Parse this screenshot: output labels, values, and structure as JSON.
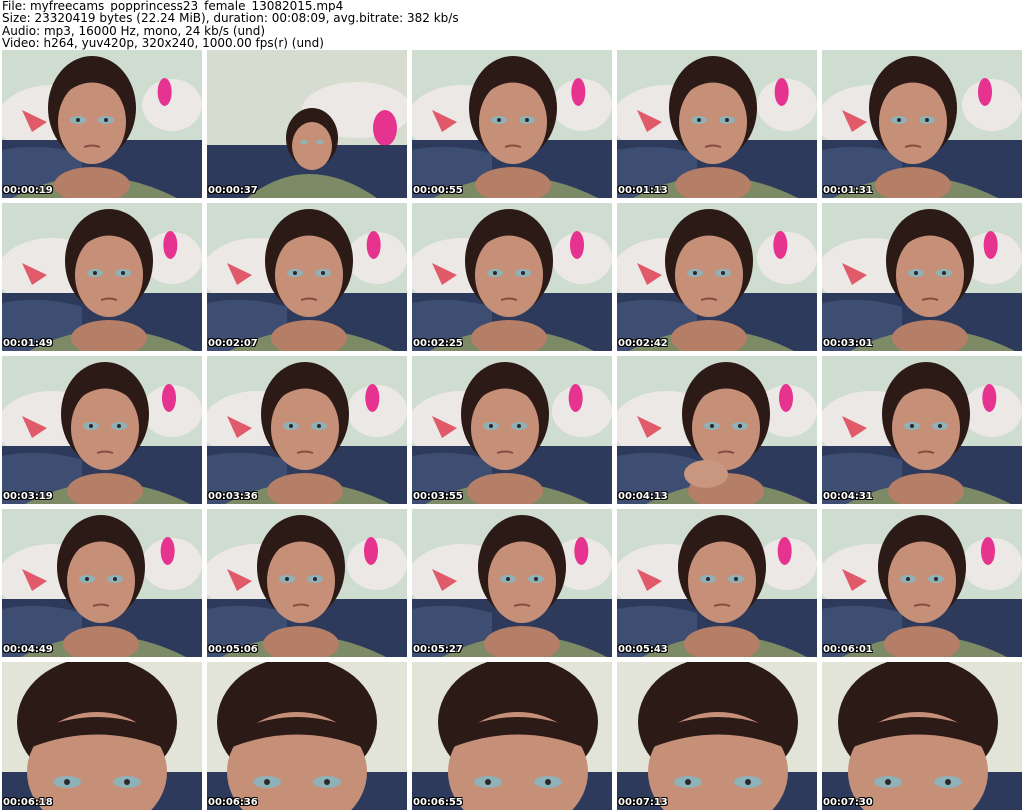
{
  "header": {
    "file_line": "File: myfreecams_popprincess23_female_13082015.mp4",
    "size_line": "Size: 23320419 bytes (22.24 MiB), duration: 00:08:09, avg.bitrate: 382 kb/s",
    "audio_line": "Audio: mp3, 16000 Hz, mono, 24 kb/s (und)",
    "video_line": "Video: h264, yuv420p, 320x240, 1000.00 fps(r) (und)"
  },
  "thumbnails": [
    {
      "timestamp": "00:00:19",
      "pose": "face"
    },
    {
      "timestamp": "00:00:37",
      "pose": "lying"
    },
    {
      "timestamp": "00:00:55",
      "pose": "face"
    },
    {
      "timestamp": "00:01:13",
      "pose": "face"
    },
    {
      "timestamp": "00:01:31",
      "pose": "face"
    },
    {
      "timestamp": "00:01:49",
      "pose": "face"
    },
    {
      "timestamp": "00:02:07",
      "pose": "face"
    },
    {
      "timestamp": "00:02:25",
      "pose": "face"
    },
    {
      "timestamp": "00:02:42",
      "pose": "face"
    },
    {
      "timestamp": "00:03:01",
      "pose": "face"
    },
    {
      "timestamp": "00:03:19",
      "pose": "face"
    },
    {
      "timestamp": "00:03:36",
      "pose": "face"
    },
    {
      "timestamp": "00:03:55",
      "pose": "face"
    },
    {
      "timestamp": "00:04:13",
      "pose": "hand"
    },
    {
      "timestamp": "00:04:31",
      "pose": "face"
    },
    {
      "timestamp": "00:04:49",
      "pose": "face"
    },
    {
      "timestamp": "00:05:06",
      "pose": "face"
    },
    {
      "timestamp": "00:05:27",
      "pose": "face"
    },
    {
      "timestamp": "00:05:43",
      "pose": "face"
    },
    {
      "timestamp": "00:06:01",
      "pose": "face"
    },
    {
      "timestamp": "00:06:18",
      "pose": "close"
    },
    {
      "timestamp": "00:06:36",
      "pose": "close"
    },
    {
      "timestamp": "00:06:55",
      "pose": "close"
    },
    {
      "timestamp": "00:07:13",
      "pose": "close"
    },
    {
      "timestamp": "00:07:30",
      "pose": "close"
    }
  ],
  "colors": {
    "wall": "#cfdcd0",
    "pillow": "#ece8e6",
    "pillow_accent": "#e05a6a",
    "bow": "#e6338f",
    "blanket": "#2d3a5c",
    "hair": "#2b1a16",
    "skin": "#c58f78",
    "shirt": "#7d8a66",
    "eyes": "#8fb2b8"
  }
}
